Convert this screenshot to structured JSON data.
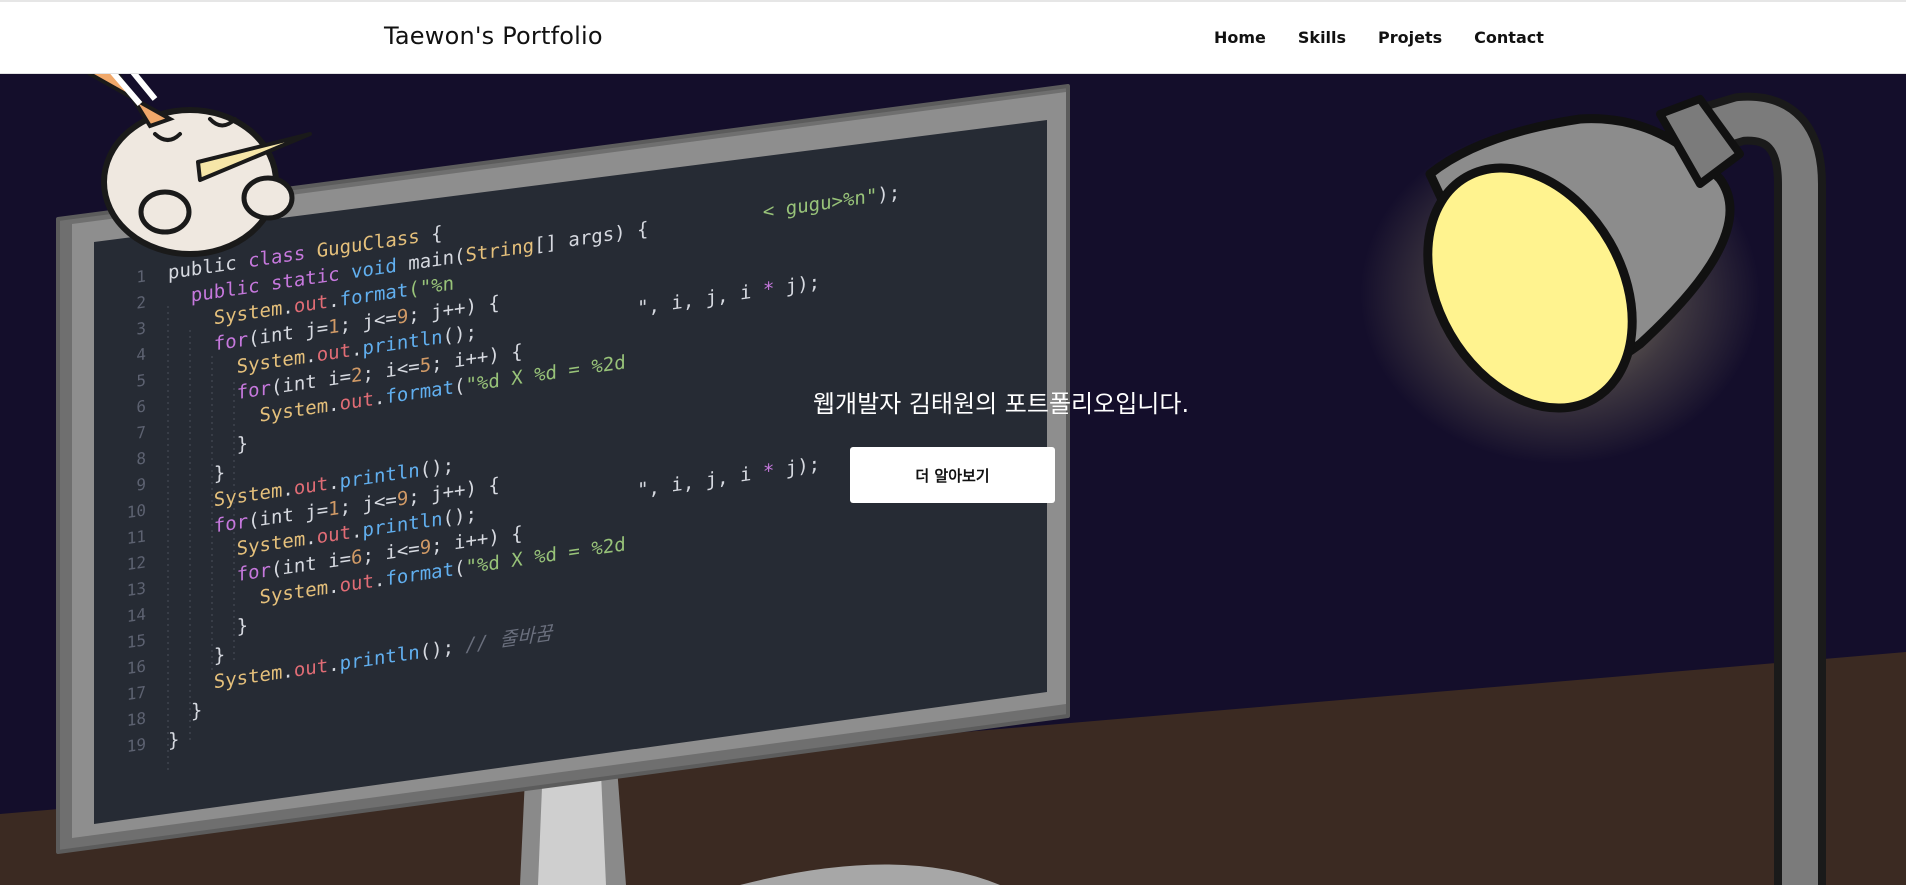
{
  "navbar": {
    "brand": "Taewon's Portfolio",
    "items": [
      {
        "label": "Home"
      },
      {
        "label": "Skills"
      },
      {
        "label": "Projets"
      },
      {
        "label": "Contact"
      }
    ]
  },
  "hero": {
    "headline": "웹개발자 김태원의 포트폴리오입니다.",
    "button_label": "더 알아보기"
  },
  "code_editor": {
    "line_numbers": [
      "1",
      "2",
      "3",
      "4",
      "5",
      "6",
      "7",
      "8",
      "9",
      "10",
      "11",
      "12",
      "13",
      "14",
      "15",
      "16",
      "17",
      "18",
      "19"
    ],
    "lines": [
      [
        [
          "plain",
          "public "
        ],
        [
          "kw",
          "class "
        ],
        [
          "cls",
          "GuguClass "
        ],
        [
          "plain",
          "{"
        ]
      ],
      [
        [
          "plain",
          "  "
        ],
        [
          "kw",
          "public static "
        ],
        [
          "fn",
          "void "
        ],
        [
          "plain",
          "main("
        ],
        [
          "cls",
          "String"
        ],
        [
          "plain",
          "[] args) {"
        ],
        [
          "str",
          "          < gugu>%n\""
        ],
        [
          "plain",
          ");"
        ]
      ],
      [
        [
          "plain",
          "    "
        ],
        [
          "cls",
          "System"
        ],
        [
          "plain",
          "."
        ],
        [
          "fld",
          "out"
        ],
        [
          "plain",
          "."
        ],
        [
          "fn",
          "format"
        ],
        [
          "str",
          "(\"%n"
        ]
      ],
      [
        [
          "plain",
          "    "
        ],
        [
          "kw",
          "for"
        ],
        [
          "plain",
          "(int j="
        ],
        [
          "num",
          "1"
        ],
        [
          "plain",
          "; j<="
        ],
        [
          "num",
          "9"
        ],
        [
          "plain",
          "; j++) {"
        ]
      ],
      [
        [
          "plain",
          "      "
        ],
        [
          "cls",
          "System"
        ],
        [
          "plain",
          "."
        ],
        [
          "fld",
          "out"
        ],
        [
          "plain",
          "."
        ],
        [
          "fn",
          "println"
        ],
        [
          "plain",
          "();"
        ],
        [
          "plain",
          "              \", i, j, i "
        ],
        [
          "sym",
          "*"
        ],
        [
          "plain",
          " j);"
        ]
      ],
      [
        [
          "plain",
          "      "
        ],
        [
          "kw",
          "for"
        ],
        [
          "plain",
          "(int i="
        ],
        [
          "num",
          "2"
        ],
        [
          "plain",
          "; i<="
        ],
        [
          "num",
          "5"
        ],
        [
          "plain",
          "; i++) {"
        ]
      ],
      [
        [
          "plain",
          "        "
        ],
        [
          "cls",
          "System"
        ],
        [
          "plain",
          "."
        ],
        [
          "fld",
          "out"
        ],
        [
          "plain",
          "."
        ],
        [
          "fn",
          "format"
        ],
        [
          "plain",
          "("
        ],
        [
          "str",
          "\"%d X %d = %2d"
        ]
      ],
      [
        [
          "plain",
          "      }"
        ]
      ],
      [
        [
          "plain",
          "    }"
        ]
      ],
      [
        [
          "plain",
          "    "
        ],
        [
          "cls",
          "System"
        ],
        [
          "plain",
          "."
        ],
        [
          "fld",
          "out"
        ],
        [
          "plain",
          "."
        ],
        [
          "fn",
          "println"
        ],
        [
          "plain",
          "();"
        ]
      ],
      [
        [
          "plain",
          "    "
        ],
        [
          "kw",
          "for"
        ],
        [
          "plain",
          "(int j="
        ],
        [
          "num",
          "1"
        ],
        [
          "plain",
          "; j<="
        ],
        [
          "num",
          "9"
        ],
        [
          "plain",
          "; j++) {"
        ]
      ],
      [
        [
          "plain",
          "      "
        ],
        [
          "cls",
          "System"
        ],
        [
          "plain",
          "."
        ],
        [
          "fld",
          "out"
        ],
        [
          "plain",
          "."
        ],
        [
          "fn",
          "println"
        ],
        [
          "plain",
          "();"
        ],
        [
          "plain",
          "              \", i, j, i "
        ],
        [
          "sym",
          "*"
        ],
        [
          "plain",
          " j);"
        ]
      ],
      [
        [
          "plain",
          "      "
        ],
        [
          "kw",
          "for"
        ],
        [
          "plain",
          "(int i="
        ],
        [
          "num",
          "6"
        ],
        [
          "plain",
          "; i<="
        ],
        [
          "num",
          "9"
        ],
        [
          "plain",
          "; i++) {"
        ]
      ],
      [
        [
          "plain",
          "        "
        ],
        [
          "cls",
          "System"
        ],
        [
          "plain",
          "."
        ],
        [
          "fld",
          "out"
        ],
        [
          "plain",
          "."
        ],
        [
          "fn",
          "format"
        ],
        [
          "plain",
          "("
        ],
        [
          "str",
          "\"%d X %d = %2d"
        ]
      ],
      [
        [
          "plain",
          "      }"
        ]
      ],
      [
        [
          "plain",
          "    }"
        ]
      ],
      [
        [
          "plain",
          "    "
        ],
        [
          "cls",
          "System"
        ],
        [
          "plain",
          "."
        ],
        [
          "fld",
          "out"
        ],
        [
          "plain",
          "."
        ],
        [
          "fn",
          "println"
        ],
        [
          "plain",
          "(); "
        ],
        [
          "cmt",
          "// 줄바꿈"
        ]
      ],
      [
        [
          "plain",
          "  }"
        ]
      ],
      [
        [
          "plain",
          "}"
        ]
      ]
    ]
  },
  "colors": {
    "hero_background": "#140e2b",
    "desk": "#3b2a22",
    "monitor_frame": "#8f8f8f",
    "screen": "#262b34",
    "lamp_light": "#fff38f",
    "button_background": "#ffffff"
  }
}
